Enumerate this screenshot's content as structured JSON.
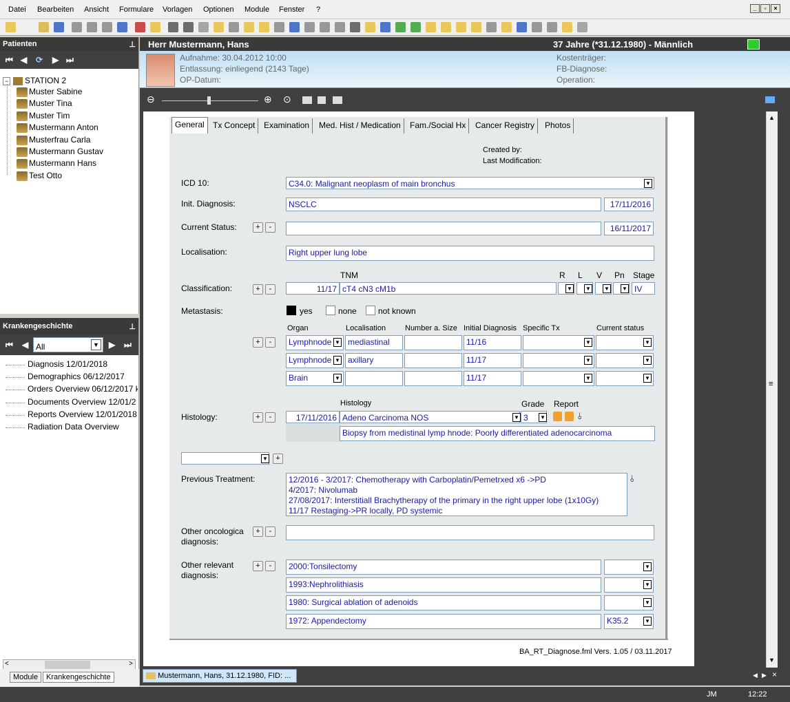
{
  "menu": [
    "Datei",
    "Bearbeiten",
    "Ansicht",
    "Formulare",
    "Vorlagen",
    "Optionen",
    "Module",
    "Fenster",
    "?"
  ],
  "left": {
    "patients_title": "Patienten",
    "station": "STATION 2",
    "patients": [
      "Muster Sabine",
      "Muster Tina",
      "Muster Tim",
      "Mustermann Anton",
      "Musterfrau Carla",
      "Mustermann Gustav",
      "Mustermann Hans",
      "Test Otto"
    ],
    "history_title": "Krankengeschichte",
    "filter_value": "All",
    "history_items": [
      "Diagnosis 12/01/2018",
      "Demographics 06/12/2017",
      "Orders Overview 06/12/2017 k",
      "Documents Overview  12/01/2",
      "Reports Overview  12/01/2018",
      "Radiation Data Overview"
    ],
    "bottom_tabs": [
      "Module",
      "Krankengeschichte"
    ]
  },
  "patient": {
    "name": "Herr Mustermann, Hans",
    "age_info": "37 Jahre (*31.12.1980) - Männlich",
    "aufnahme": "Aufnahme: 30.04.2012 10:00",
    "entlassung": "Entlassung: einliegend (2143 Tage)",
    "op_datum": "OP-Datum:",
    "kostentraeger": "Kostenträger:",
    "fb_diagnose": "FB-Diagnose:",
    "operation": "Operation:"
  },
  "tabs": [
    "General",
    "Tx Concept",
    "Examination",
    "Med. Hist / Medication",
    "Fam./Social Hx",
    "Cancer Registry",
    "Photos"
  ],
  "form": {
    "created_by": "Created by:",
    "last_mod": "Last Modification:",
    "icd_label": "ICD 10:",
    "icd_value": "C34.0: Malignant neoplasm of main bronchus",
    "init_label": "Init. Diagnosis:",
    "init_value": "NSCLC",
    "init_date": "17/11/2016",
    "status_label": "Current Status:",
    "status_date": "16/11/2017",
    "loc_label": "Localisation:",
    "loc_value": "Right upper lung lobe",
    "class_label": "Classification:",
    "tnm_header": "TNM",
    "r_header": "R",
    "l_header": "L",
    "v_header": "V",
    "pn_header": "Pn",
    "stage_header": "Stage",
    "class_date": "11/17",
    "tnm_value": "cT4 cN3 cM1b",
    "stage_value": "IV",
    "meta_label": "Metastasis:",
    "meta_yes": "yes",
    "meta_none": "none",
    "meta_unknown": "not known",
    "meta_headers": [
      "Organ",
      "Localisation",
      "Number a. Size",
      "Initial Diagnosis",
      "Specific Tx",
      "Current status"
    ],
    "meta_rows": [
      {
        "organ": "Lymphnode",
        "loc": "mediastinal",
        "diag": "11/16"
      },
      {
        "organ": "Lymphnode",
        "loc": "axillary",
        "diag": "11/17"
      },
      {
        "organ": "Brain",
        "loc": "",
        "diag": "11/17"
      }
    ],
    "hist_label": "Histology:",
    "hist_header": "Histology",
    "grade_header": "Grade",
    "report_header": "Report",
    "hist_date": "17/11/2016",
    "hist_value": "Adeno Carcinoma NOS",
    "grade_value": "3",
    "hist_note": "Biopsy from medistinal lymp hnode: Poorly differentiated adenocarcinoma",
    "prev_label": "Previous Treatment:",
    "prev_lines": [
      "12/2016 - 3/2017: Chemotherapy with Carboplatin/Pemetrxed x6 ->PD",
      "4/2017: Nivolumab",
      "27/08/2017: Interstitiall Brachytherapy of the primary in the right upper lobe (1x10Gy)",
      "11/17 Restaging->PR locally, PD systemic"
    ],
    "other_onc_label1": "Other oncologica",
    "other_onc_label2": "diagnosis:",
    "other_rel_label1": "Other relevant",
    "other_rel_label2": "diagnosis:",
    "other_rel": [
      {
        "text": "2000:Tonsilectomy",
        "code": ""
      },
      {
        "text": "1993:Nephrolithiasis",
        "code": ""
      },
      {
        "text": "1980: Surgical ablation of adenoids",
        "code": ""
      },
      {
        "text": "1972: Appendectomy",
        "code": "K35.2"
      }
    ],
    "footer": "BA_RT_Diagnose.fml    Vers. 1.05 / 03.11.2017"
  },
  "doc_tab": "Mustermann, Hans, 31.12.1980, FID: ...",
  "status": {
    "user": "JM",
    "time": "12:22"
  },
  "colors": {
    "dark": "#404040",
    "field_text": "#1a1aa6",
    "form_bg": "#e6eaea"
  }
}
